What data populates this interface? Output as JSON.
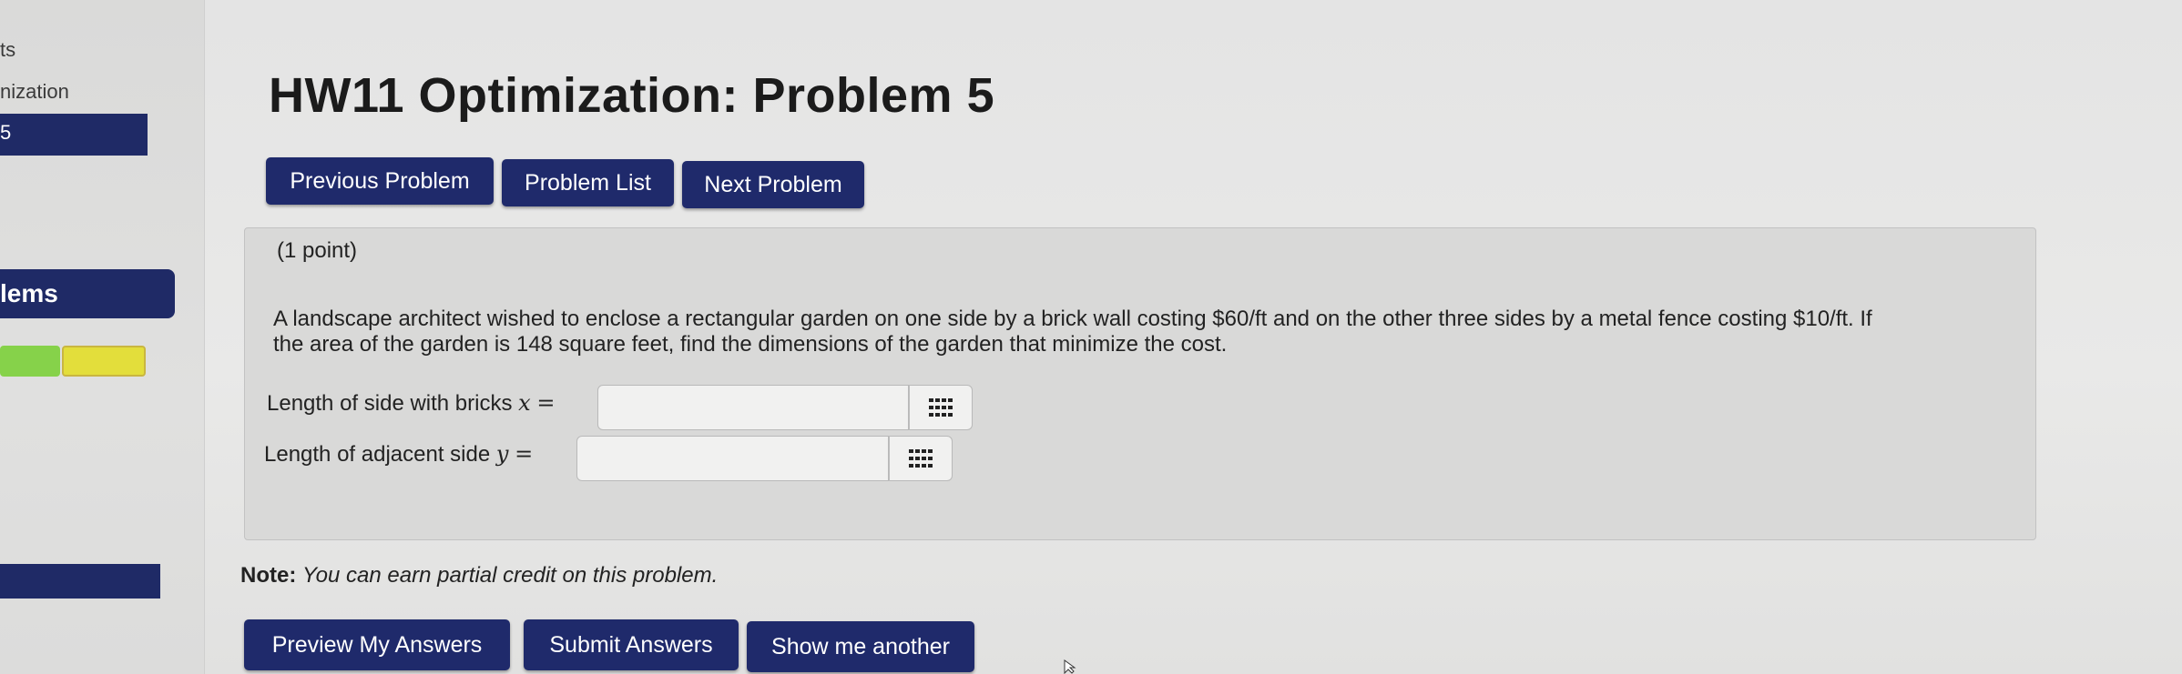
{
  "sidebar": {
    "fragment_1": "ts",
    "fragment_2": "nization",
    "fragment_3": "5",
    "section_heading": "lems"
  },
  "page": {
    "title": "HW11 Optimization: Problem 5"
  },
  "nav": {
    "previous_label": "Previous Problem",
    "list_label": "Problem List",
    "next_label": "Next Problem"
  },
  "problem": {
    "points": "(1 point)",
    "statement_line1": "A landscape architect wished to enclose a rectangular garden on one side by a brick wall costing $60/ft and on the other three sides by a metal fence costing $10/ft. If",
    "statement_line2": "the area of the garden is 148 square feet, find the dimensions of the garden that minimize the cost.",
    "answer_x_label": "Length of side with bricks",
    "answer_x_var": "x",
    "answer_x_value": "",
    "answer_y_label": "Length of adjacent side",
    "answer_y_var": "y",
    "answer_y_value": "",
    "equals": "="
  },
  "note": {
    "label": "Note:",
    "text": "You can earn partial credit on this problem."
  },
  "actions": {
    "preview_label": "Preview My Answers",
    "submit_label": "Submit Answers",
    "another_label": "Show me another"
  },
  "colors": {
    "button_navy": "#1f2a6b",
    "progress_green": "#86d24a",
    "progress_yellow": "#e3de3b",
    "panel_gray": "#d9d9d8"
  },
  "icons": {
    "keypad": "keypad-grid-icon",
    "cursor": "mouse-pointer-icon"
  }
}
